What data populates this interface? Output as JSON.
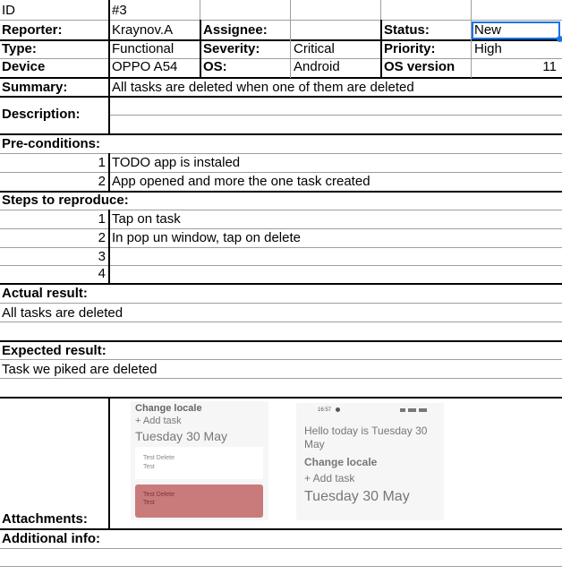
{
  "rows": {
    "id": {
      "label": "ID",
      "value": "#3"
    },
    "reporter": {
      "label": "Reporter:",
      "value": "Kraynov.A"
    },
    "assignee": {
      "label": "Assignee:",
      "value": ""
    },
    "status": {
      "label": "Status:",
      "value": "New"
    },
    "type": {
      "label": "Type:",
      "value": "Functional"
    },
    "severity": {
      "label": "Severity:",
      "value": "Critical"
    },
    "priority": {
      "label": "Priority:",
      "value": "High"
    },
    "device": {
      "label": "Device",
      "value": "OPPO A54"
    },
    "os": {
      "label": "OS:",
      "value": "Android"
    },
    "os_version": {
      "label": "OS version",
      "value": "11"
    },
    "summary": {
      "label": "Summary:",
      "value": "All tasks are deleted when one of them are deleted"
    },
    "description": {
      "label": "Description:"
    }
  },
  "preconditions": {
    "label": "Pre-conditions:",
    "items": [
      {
        "n": "1",
        "text": "TODO app is instaled"
      },
      {
        "n": "2",
        "text": "App opened  and more the one task created"
      }
    ]
  },
  "steps": {
    "label": "Steps to reproduce:",
    "items": [
      {
        "n": "1",
        "text": "Tap on task"
      },
      {
        "n": "2",
        "text": "In pop un window, tap on delete"
      },
      {
        "n": "3",
        "text": ""
      },
      {
        "n": "4",
        "text": ""
      }
    ]
  },
  "actual": {
    "label": "Actual result:",
    "text": "All tasks are deleted"
  },
  "expected": {
    "label": "Expected result:",
    "text": "Task we piked are deleted"
  },
  "attachments": {
    "label": "Attachments:",
    "shot1": {
      "title": "Change locale",
      "add": "+ Add task",
      "date": "Tuesday 30 May",
      "card1": [
        "Test Delete",
        "Test"
      ],
      "card2": [
        "Test Delete",
        "Test"
      ]
    },
    "shot2": {
      "time": "16:57",
      "hello": "Hello today is Tuesday 30 May",
      "title": "Change locale",
      "add": "+ Add task",
      "date": "Tuesday 30 May"
    }
  },
  "additional": {
    "label": "Additional info:"
  },
  "colors": {
    "selection": "#1a73e8",
    "grid": "#9e9e9e",
    "delete_card": "#c97b7b"
  }
}
